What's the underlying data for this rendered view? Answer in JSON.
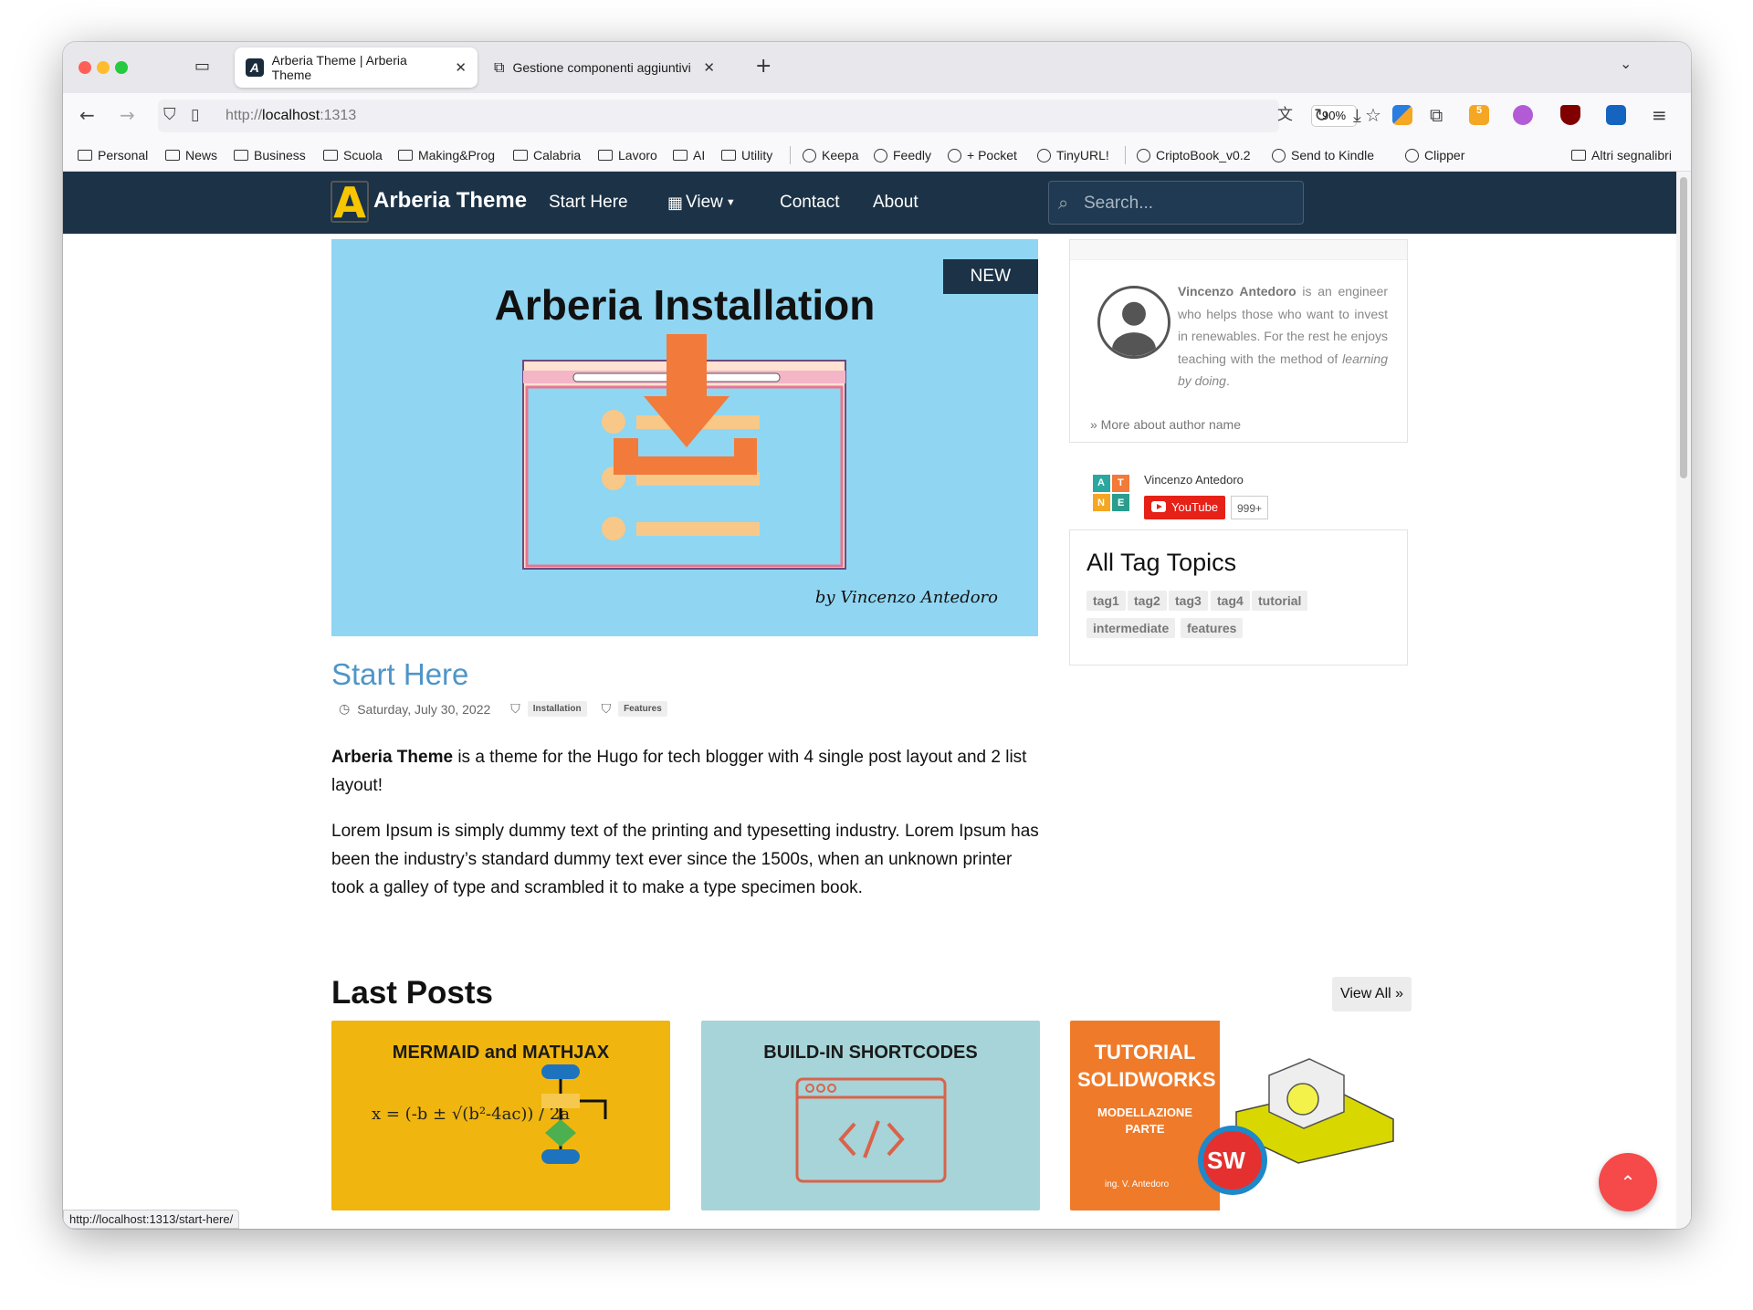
{
  "browser": {
    "tabs": [
      {
        "label": "Arberia Theme | Arberia Theme"
      },
      {
        "label": "Gestione componenti aggiuntivi"
      }
    ],
    "url_prefix": "http://",
    "url_host": "localhost",
    "url_port": ":1313",
    "zoom": "90%",
    "status_url": "http://localhost:1313/start-here/",
    "bookmarks": [
      "Personal",
      "News",
      "Business",
      "Scuola",
      "Making&Prog",
      "Calabria",
      "Lavoro",
      "AI",
      "Utility",
      "Keepa",
      "Feedly",
      "+ Pocket",
      "TinyURL!",
      "CriptoBook_v0.2",
      "Send to Kindle",
      "Clipper",
      "Altri segnalibri"
    ],
    "extension_badge": "5"
  },
  "nav": {
    "logo_letter": "A",
    "brand": "Arberia Theme",
    "links": [
      "Start Here",
      "View",
      "Contact",
      "About"
    ],
    "search_placeholder": "Search..."
  },
  "hero": {
    "badge": "NEW",
    "image_title": "Arberia Installation",
    "signature": "by Vincenzo Antedoro"
  },
  "post": {
    "title": "Start Here",
    "date": "Saturday, July 30, 2022",
    "tags": [
      "Installation",
      "Features"
    ],
    "intro_bold": "Arberia Theme",
    "intro_rest": " is a theme for the Hugo for tech blogger with 4 single post layout and 2 list layout!",
    "lorem": "Lorem Ipsum is simply dummy text of the printing and typesetting industry. Lorem Ipsum has been the industry’s standard dummy text ever since the 1500s, when an unknown printer took a galley of type and scrambled it to make a type specimen book."
  },
  "sidebar": {
    "author_name": "Vincenzo Antedoro",
    "author_bio_a": " is an engineer who helps those who want to invest in renewables. For the rest he enjoys teaching with the method of ",
    "author_bio_em": "learning by doing",
    "author_bio_end": ".",
    "more_link": "» More about author name",
    "youtube_channel": "Vincenzo Antedoro",
    "youtube_label": "YouTube",
    "youtube_count": "999+",
    "youtube_logo_letters": [
      "A",
      "T",
      "N",
      "E"
    ],
    "tags_title": "All Tag Topics",
    "tags": [
      "tag1",
      "tag2",
      "tag3",
      "tag4",
      "tutorial",
      "intermediate",
      "features"
    ]
  },
  "last_posts": {
    "title": "Last Posts",
    "view_all": "View All »",
    "cards": [
      {
        "title": "MERMAID and MATHJAX",
        "formula": "x = (-b ± √(b²-4ac)) / 2a",
        "bg": "#f0b60f"
      },
      {
        "title": "BUILD-IN SHORTCODES",
        "bg": "#a6d4d8"
      },
      {
        "title": "TUTORIAL SOLIDWORKS",
        "subtitle": "MODELLAZIONE PARTE",
        "author": "ing. V. Antedoro",
        "logo": "SW",
        "bg": "#ef7a29"
      }
    ]
  },
  "colors": {
    "navbar": "#1b3247",
    "accent_link": "#4f95c8",
    "hero_bg": "#90d6f2",
    "fab": "#f5494a",
    "logo_yellow": "#f7c600"
  }
}
